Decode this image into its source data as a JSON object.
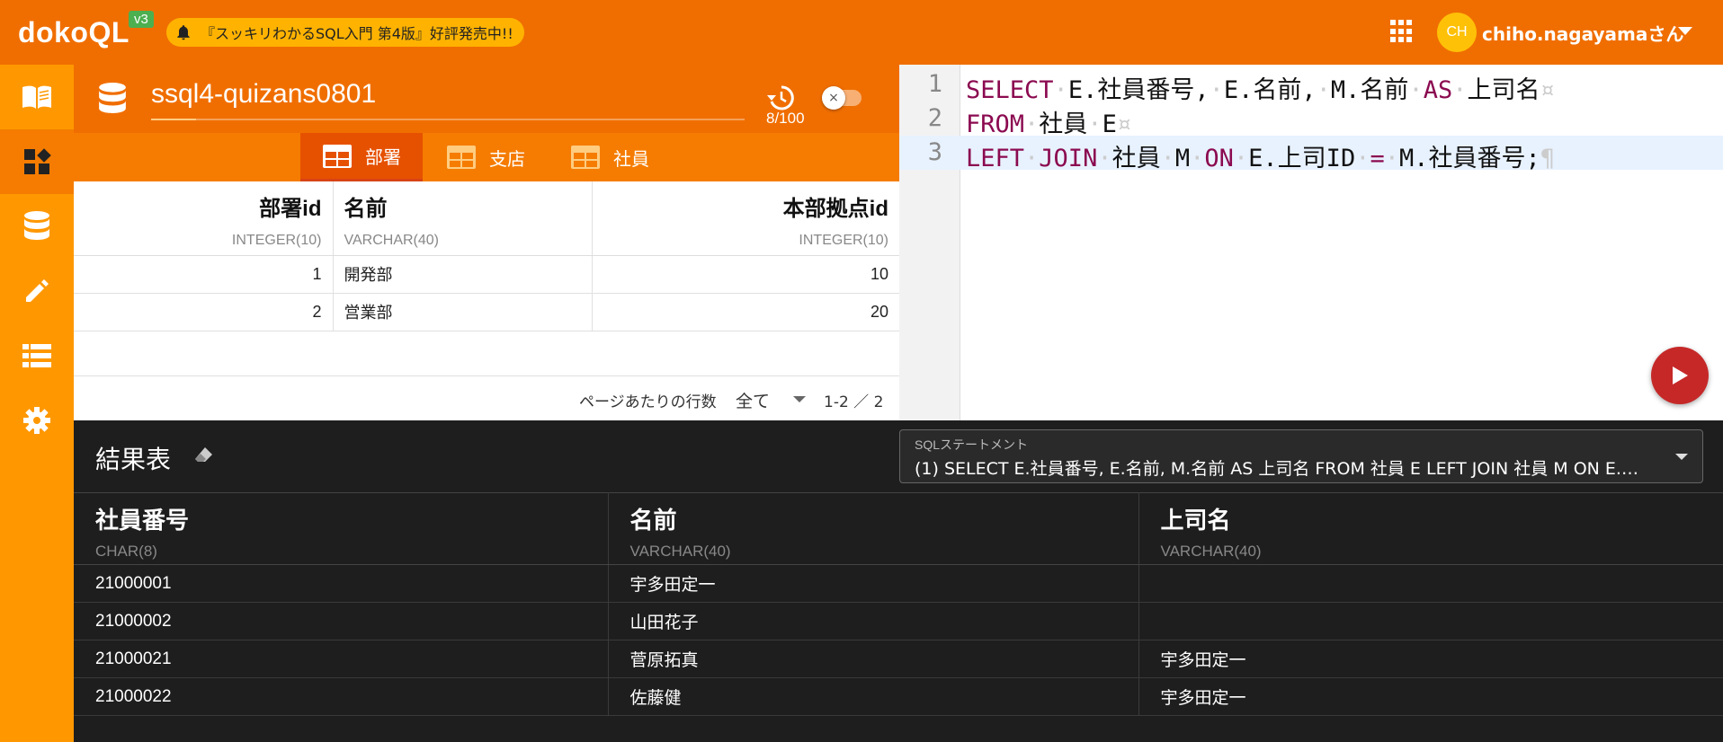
{
  "app": {
    "logo": "dokoQL",
    "version": "v3",
    "announcement": "『スッキリわかるSQL入門 第4版』好評発売中!!",
    "avatar_initials": "CH",
    "username": "chiho.nagayamaさん"
  },
  "sidebar": {
    "items": [
      {
        "name": "book",
        "active": false
      },
      {
        "name": "widgets",
        "active": true
      },
      {
        "name": "database",
        "active": false
      },
      {
        "name": "pencil",
        "active": false
      },
      {
        "name": "list",
        "active": false
      },
      {
        "name": "gear",
        "active": false
      }
    ]
  },
  "db_panel": {
    "db_name": "ssql4-quizans0801",
    "history_count": "8/100",
    "toggle_symbol": "×",
    "tabs": [
      {
        "label": "部署",
        "active": true
      },
      {
        "label": "支店",
        "active": false
      },
      {
        "label": "社員",
        "active": false
      }
    ],
    "columns": [
      {
        "name": "部署id",
        "type": "INTEGER(10)"
      },
      {
        "name": "名前",
        "type": "VARCHAR(40)"
      },
      {
        "name": "本部拠点id",
        "type": "INTEGER(10)"
      }
    ],
    "rows": [
      [
        "1",
        "開発部",
        "10"
      ],
      [
        "2",
        "営業部",
        "20"
      ]
    ],
    "pager": {
      "rows_per_page_label": "ページあたりの行数",
      "rows_per_page_value": "全て",
      "range": "1-2 ／ 2"
    }
  },
  "editor": {
    "line_numbers": [
      "1",
      "2",
      "3"
    ],
    "line_end_marks": [
      "¤",
      "¤",
      "¶"
    ]
  },
  "results": {
    "title": "結果表",
    "statement_label": "SQLステートメント",
    "statement_value": "(1) SELECT E.社員番号, E.名前, M.名前 AS 上司名 FROM 社員 E LEFT JOIN 社員 M ON E.上司ID = M.社員番号;",
    "columns": [
      {
        "name": "社員番号",
        "type": "CHAR(8)"
      },
      {
        "name": "名前",
        "type": "VARCHAR(40)"
      },
      {
        "name": "上司名",
        "type": "VARCHAR(40)"
      }
    ],
    "rows": [
      [
        "21000001",
        "宇多田定一",
        ""
      ],
      [
        "21000002",
        "山田花子",
        ""
      ],
      [
        "21000021",
        "菅原拓真",
        "宇多田定一"
      ],
      [
        "21000022",
        "佐藤健",
        "宇多田定一"
      ]
    ]
  },
  "colors": {
    "brand_orange": "#f06e00",
    "sidebar_orange": "#ff9800",
    "keyword": "#8b0a50",
    "run_button": "#c62828"
  }
}
